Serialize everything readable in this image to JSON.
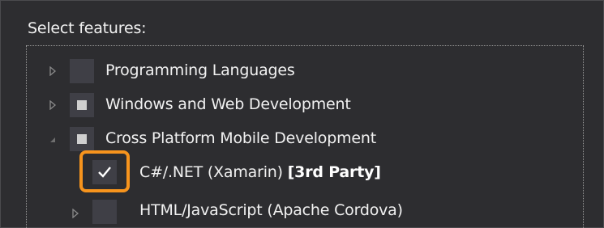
{
  "panel": {
    "title": "Select features:"
  },
  "tree": {
    "items": [
      {
        "label": "Programming Languages",
        "state": "unchecked",
        "expander": "collapsed"
      },
      {
        "label": "Windows and Web Development",
        "state": "partial",
        "expander": "collapsed"
      },
      {
        "label": "Cross Platform Mobile Development",
        "state": "partial",
        "expander": "expanded"
      },
      {
        "label": "C#/.NET (Xamarin)",
        "tag": "[3rd Party]",
        "state": "checked",
        "expander": "none"
      },
      {
        "label": "HTML/JavaScript (Apache Cordova)",
        "state": "unchecked",
        "expander": "collapsed"
      }
    ]
  },
  "colors": {
    "background": "#2d2d30",
    "checkbox": "#3f3f46",
    "highlight": "#f7941d",
    "text": "#f1f1f1"
  }
}
